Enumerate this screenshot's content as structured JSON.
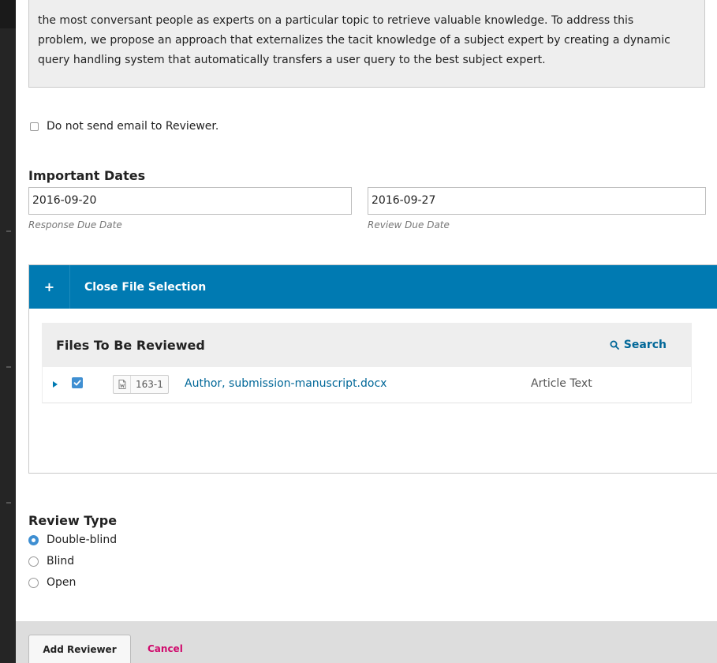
{
  "message": {
    "lines": [
      "the most conversant people as experts on a particular topic to retrieve valuable knowledge. To address this",
      "problem, we propose an approach that externalizes the tacit knowledge of a subject expert by creating a dynamic",
      "query handling system that automatically transfers a user query to the best subject expert."
    ]
  },
  "email_option": {
    "label": "Do not send email to Reviewer.",
    "checked": false
  },
  "important_dates": {
    "title": "Important Dates",
    "response_due": {
      "value": "2016-09-20",
      "label": "Response Due Date"
    },
    "review_due": {
      "value": "2016-09-27",
      "label": "Review Due Date"
    }
  },
  "file_selection": {
    "toggle_icon": "plus-icon",
    "toggle_glyph": "+",
    "title": "Close File Selection",
    "grid_title": "Files To Be Reviewed",
    "search_label": "Search",
    "files": [
      {
        "checked": true,
        "id": "163-1",
        "name": "Author, submission-manuscript.docx",
        "type": "Article Text"
      }
    ]
  },
  "review_type": {
    "title": "Review Type",
    "options": [
      {
        "label": "Double-blind",
        "selected": true
      },
      {
        "label": "Blind",
        "selected": false
      },
      {
        "label": "Open",
        "selected": false
      }
    ]
  },
  "footer": {
    "add_label": "Add Reviewer",
    "cancel_label": "Cancel"
  },
  "colors": {
    "accent": "#007ab2",
    "link": "#006798",
    "cancel": "#d00a6c",
    "checkbox": "#3f8fd2"
  }
}
